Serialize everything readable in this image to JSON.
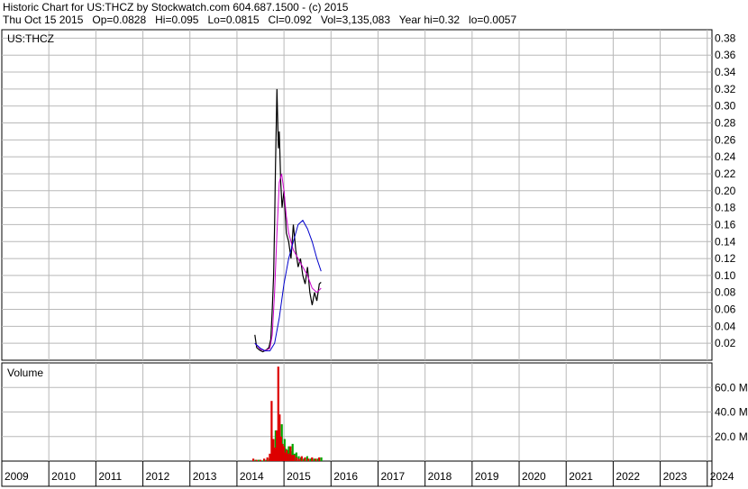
{
  "header": {
    "title": "Historic Chart for US:THCZ by Stockwatch.com 604.687.1500 - (c) 2015",
    "quote": "Thu Oct 15 2015   Op=0.0828   Hi=0.095   Lo=0.0815   Cl=0.092   Vol=3,135,083   Year hi=0.32   lo=0.0057"
  },
  "chart_data": [
    {
      "type": "line",
      "title": "US:THCZ",
      "ylim": [
        0,
        0.39
      ],
      "y_ticks": [
        "0.02",
        "0.04",
        "0.06",
        "0.08",
        "0.10",
        "0.12",
        "0.14",
        "0.16",
        "0.18",
        "0.20",
        "0.22",
        "0.24",
        "0.26",
        "0.28",
        "0.30",
        "0.32",
        "0.34",
        "0.36",
        "0.38"
      ],
      "grid": true,
      "series": [
        {
          "color": "#000000",
          "x": [
            2014.38,
            2014.42,
            2014.48,
            2014.55,
            2014.62,
            2014.68,
            2014.72,
            2014.75,
            2014.78,
            2014.8,
            2014.82,
            2014.85,
            2014.88,
            2014.9,
            2014.93,
            2014.96,
            2015.0,
            2015.05,
            2015.1,
            2015.15,
            2015.2,
            2015.25,
            2015.3,
            2015.35,
            2015.4,
            2015.45,
            2015.5,
            2015.55,
            2015.6,
            2015.65,
            2015.7,
            2015.75,
            2015.79
          ],
          "y": [
            0.03,
            0.015,
            0.012,
            0.01,
            0.012,
            0.015,
            0.025,
            0.06,
            0.1,
            0.16,
            0.23,
            0.32,
            0.25,
            0.27,
            0.21,
            0.18,
            0.2,
            0.15,
            0.14,
            0.12,
            0.16,
            0.13,
            0.11,
            0.12,
            0.1,
            0.09,
            0.11,
            0.08,
            0.065,
            0.08,
            0.07,
            0.09,
            0.092
          ]
        },
        {
          "color": "#cc00cc",
          "x": [
            2014.38,
            2014.5,
            2014.6,
            2014.7,
            2014.75,
            2014.8,
            2014.85,
            2014.9,
            2014.95,
            2015.0,
            2015.05,
            2015.1,
            2015.2,
            2015.3,
            2015.4,
            2015.5,
            2015.6,
            2015.7,
            2015.79
          ],
          "y": [
            0.02,
            0.013,
            0.011,
            0.014,
            0.03,
            0.08,
            0.15,
            0.21,
            0.22,
            0.2,
            0.17,
            0.15,
            0.13,
            0.12,
            0.11,
            0.1,
            0.085,
            0.08,
            0.085
          ]
        },
        {
          "color": "#0000cc",
          "x": [
            2014.38,
            2014.5,
            2014.6,
            2014.7,
            2014.8,
            2014.9,
            2015.0,
            2015.1,
            2015.2,
            2015.3,
            2015.4,
            2015.5,
            2015.6,
            2015.7,
            2015.79
          ],
          "y": [
            0.02,
            0.014,
            0.011,
            0.011,
            0.02,
            0.05,
            0.09,
            0.12,
            0.14,
            0.16,
            0.165,
            0.155,
            0.14,
            0.12,
            0.105
          ]
        }
      ]
    },
    {
      "type": "bar",
      "title": "Volume",
      "ylim": [
        0,
        80
      ],
      "y_ticks": [
        "20.0 M",
        "40.0 M",
        "60.0 M"
      ],
      "categories": [
        "2014.35",
        "2014.42",
        "2014.5",
        "2014.58",
        "2014.65",
        "2014.7",
        "2014.74",
        "2014.78",
        "2014.82",
        "2014.85",
        "2014.88",
        "2014.91",
        "2014.94",
        "2014.97",
        "2015.0",
        "2015.03",
        "2015.06",
        "2015.1",
        "2015.14",
        "2015.18",
        "2015.22",
        "2015.27",
        "2015.32",
        "2015.38",
        "2015.45",
        "2015.52",
        "2015.6",
        "2015.68",
        "2015.75"
      ],
      "series": [
        {
          "name": "down",
          "color": "#dd0000",
          "values": [
            2,
            1,
            1,
            2,
            3,
            6,
            49,
            18,
            11,
            25,
            77,
            38,
            20,
            14,
            12,
            7,
            9,
            6,
            12,
            5,
            5,
            3,
            2,
            4,
            3,
            2,
            3,
            2,
            3
          ]
        },
        {
          "name": "up",
          "color": "#00aa00",
          "values": [
            1,
            1,
            0.5,
            1,
            2,
            5,
            6,
            25,
            14,
            15,
            10,
            30,
            12,
            18,
            10,
            9,
            12,
            8,
            14,
            6,
            7,
            4,
            3,
            2,
            4,
            2,
            2,
            2,
            3
          ]
        }
      ]
    }
  ],
  "x_axis": {
    "labels": [
      "2009",
      "2010",
      "2011",
      "2012",
      "2013",
      "2014",
      "2015",
      "2016",
      "2017",
      "2018",
      "2019",
      "2020",
      "2021",
      "2022",
      "2023",
      "2024"
    ]
  },
  "colors": {
    "background": "#ffffff",
    "grid": "#b8b8b8",
    "frame": "#000000"
  }
}
